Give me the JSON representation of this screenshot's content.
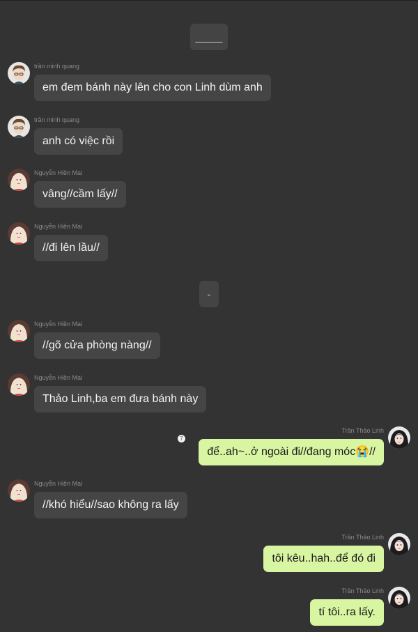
{
  "system_notes": [
    "_____",
    "-"
  ],
  "participants": {
    "quang": "trần minh quang",
    "mai": "Nguyễn Hiền Mai",
    "linh": "Trần Thảo Linh"
  },
  "messages": [
    {
      "side": "left",
      "sender": "trần minh quang",
      "avatar": "avatar-quang",
      "text": "em đem bánh này lên cho con Linh dùm anh"
    },
    {
      "side": "left",
      "sender": "trần minh quang",
      "avatar": "avatar-quang",
      "text": "anh có việc rồi"
    },
    {
      "side": "left",
      "sender": "Nguyễn Hiền Mai",
      "avatar": "avatar-mai",
      "text": "vâng//cầm lấy//"
    },
    {
      "side": "left",
      "sender": "Nguyễn Hiền Mai",
      "avatar": "avatar-mai",
      "text": "//đi lên lầu//"
    },
    {
      "side": "left",
      "sender": "Nguyễn Hiền Mai",
      "avatar": "avatar-mai",
      "text": "//gõ cửa phòng nàng//"
    },
    {
      "side": "left",
      "sender": "Nguyễn Hiền Mai",
      "avatar": "avatar-mai",
      "text": "Thảo Linh,ba em đưa bánh này"
    },
    {
      "side": "right",
      "sender": "Trần Thảo Linh",
      "avatar": "avatar-linh",
      "text": "để..ah~..ở ngoài đi//đang móc😭//",
      "badge": "7"
    },
    {
      "side": "left",
      "sender": "Nguyễn Hiền Mai",
      "avatar": "avatar-mai",
      "text": "//khó hiểu//sao không ra lấy"
    },
    {
      "side": "right",
      "sender": "Trần Thảo Linh",
      "avatar": "avatar-linh",
      "text": "tôi kêu..hah..để đó đi"
    },
    {
      "side": "right",
      "sender": "Trần Thảo Linh",
      "avatar": "avatar-linh",
      "text": "tí tôi..ra lấy."
    }
  ],
  "colors": {
    "background": "#333333",
    "incoming_bubble": "#454545",
    "outgoing_bubble": "#d8f5a2",
    "sender_name": "#8a8a8a"
  }
}
